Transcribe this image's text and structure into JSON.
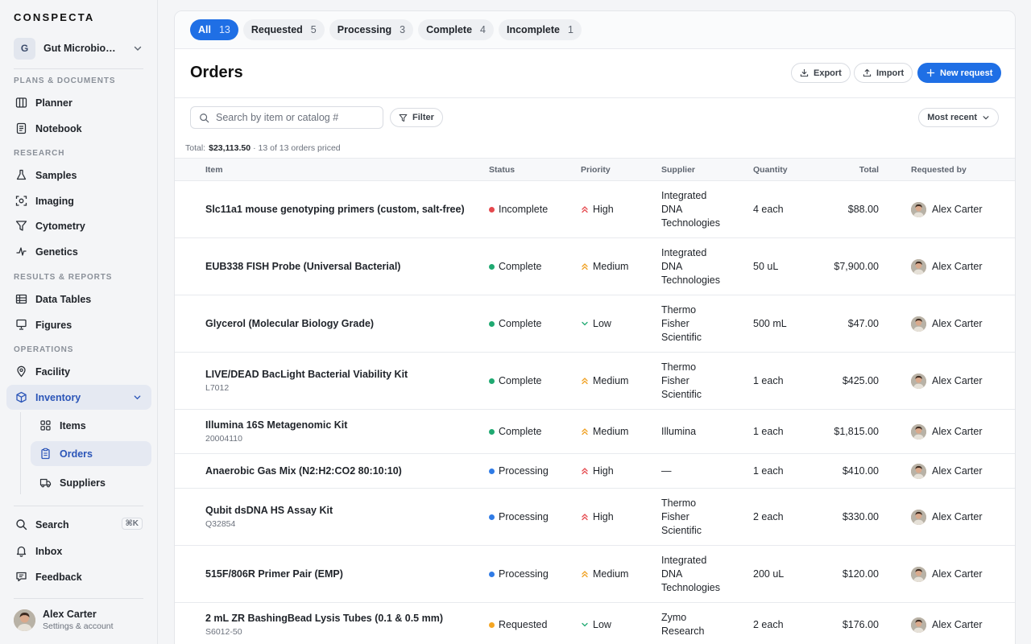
{
  "app": {
    "brand": "CONSPECTA",
    "workspace": {
      "badge": "G",
      "name": "Gut Microbiome Study"
    }
  },
  "sidebar": {
    "sections": {
      "plans": "PLANS & DOCUMENTS",
      "research": "RESEARCH",
      "results": "RESULTS & REPORTS",
      "operations": "OPERATIONS"
    },
    "items": {
      "planner": "Planner",
      "notebook": "Notebook",
      "samples": "Samples",
      "imaging": "Imaging",
      "cytometry": "Cytometry",
      "genetics": "Genetics",
      "data_tables": "Data Tables",
      "figures": "Figures",
      "facility": "Facility",
      "inventory": "Inventory",
      "items": "Items",
      "orders": "Orders",
      "suppliers": "Suppliers",
      "search": "Search",
      "search_kbd": "⌘K",
      "inbox": "Inbox",
      "feedback": "Feedback"
    },
    "user": {
      "name": "Alex Carter",
      "sub": "Settings & account"
    }
  },
  "tabs": [
    {
      "label": "All",
      "count": "13"
    },
    {
      "label": "Requested",
      "count": "5"
    },
    {
      "label": "Processing",
      "count": "3"
    },
    {
      "label": "Complete",
      "count": "4"
    },
    {
      "label": "Incomplete",
      "count": "1"
    }
  ],
  "header": {
    "title": "Orders",
    "export": "Export",
    "import": "Import",
    "new_request": "New request"
  },
  "toolbar": {
    "search_placeholder": "Search by item or catalog #",
    "filter": "Filter",
    "sort": "Most recent"
  },
  "summary": {
    "label": "Total:",
    "amount": "$23,113.50",
    "note": "· 13 of 13 orders priced"
  },
  "table": {
    "columns": {
      "item": "Item",
      "status": "Status",
      "priority": "Priority",
      "supplier": "Supplier",
      "quantity": "Quantity",
      "total": "Total",
      "requested_by": "Requested by"
    },
    "rows": [
      {
        "item": "Slc11a1 mouse genotyping primers (custom, salt-free)",
        "catalog": "",
        "status": "Incomplete",
        "priority": "High",
        "supplier": "Integrated\nDNA\nTechnologies",
        "quantity": "4 each",
        "total": "$88.00",
        "requested_by": "Alex Carter"
      },
      {
        "item": "EUB338 FISH Probe (Universal Bacterial)",
        "catalog": "",
        "status": "Complete",
        "priority": "Medium",
        "supplier": "Integrated\nDNA\nTechnologies",
        "quantity": "50 uL",
        "total": "$7,900.00",
        "requested_by": "Alex Carter"
      },
      {
        "item": "Glycerol (Molecular Biology Grade)",
        "catalog": "",
        "status": "Complete",
        "priority": "Low",
        "supplier": "Thermo\nFisher\nScientific",
        "quantity": "500 mL",
        "total": "$47.00",
        "requested_by": "Alex Carter"
      },
      {
        "item": "LIVE/DEAD BacLight Bacterial Viability Kit",
        "catalog": "L7012",
        "status": "Complete",
        "priority": "Medium",
        "supplier": "Thermo\nFisher\nScientific",
        "quantity": "1 each",
        "total": "$425.00",
        "requested_by": "Alex Carter"
      },
      {
        "item": "Illumina 16S Metagenomic Kit",
        "catalog": "20004110",
        "status": "Complete",
        "priority": "Medium",
        "supplier": "Illumina",
        "quantity": "1 each",
        "total": "$1,815.00",
        "requested_by": "Alex Carter"
      },
      {
        "item": "Anaerobic Gas Mix (N2:H2:CO2 80:10:10)",
        "catalog": "",
        "status": "Processing",
        "priority": "High",
        "supplier": "—",
        "quantity": "1 each",
        "total": "$410.00",
        "requested_by": "Alex Carter"
      },
      {
        "item": "Qubit dsDNA HS Assay Kit",
        "catalog": "Q32854",
        "status": "Processing",
        "priority": "High",
        "supplier": "Thermo\nFisher\nScientific",
        "quantity": "2 each",
        "total": "$330.00",
        "requested_by": "Alex Carter"
      },
      {
        "item": "515F/806R Primer Pair (EMP)",
        "catalog": "",
        "status": "Processing",
        "priority": "Medium",
        "supplier": "Integrated\nDNA\nTechnologies",
        "quantity": "200 uL",
        "total": "$120.00",
        "requested_by": "Alex Carter"
      },
      {
        "item": "2 mL ZR BashingBead Lysis Tubes (0.1 & 0.5 mm)",
        "catalog": "S6012-50",
        "status": "Requested",
        "priority": "Low",
        "supplier": "Zymo\nResearch",
        "quantity": "2 each",
        "total": "$176.00",
        "requested_by": "Alex Carter"
      }
    ]
  },
  "colors": {
    "accent": "#1f6fe5",
    "status": {
      "Incomplete": "#e5484d",
      "Complete": "#1fa971",
      "Processing": "#2f7be6",
      "Requested": "#f5a623"
    },
    "priority": {
      "High": "#e5484d",
      "Medium": "#f0a020",
      "Low": "#1fa971"
    }
  },
  "icons": {
    "High": "double-chevron-up-icon",
    "Medium": "double-chevron-up-icon",
    "Low": "chevron-down-icon"
  }
}
